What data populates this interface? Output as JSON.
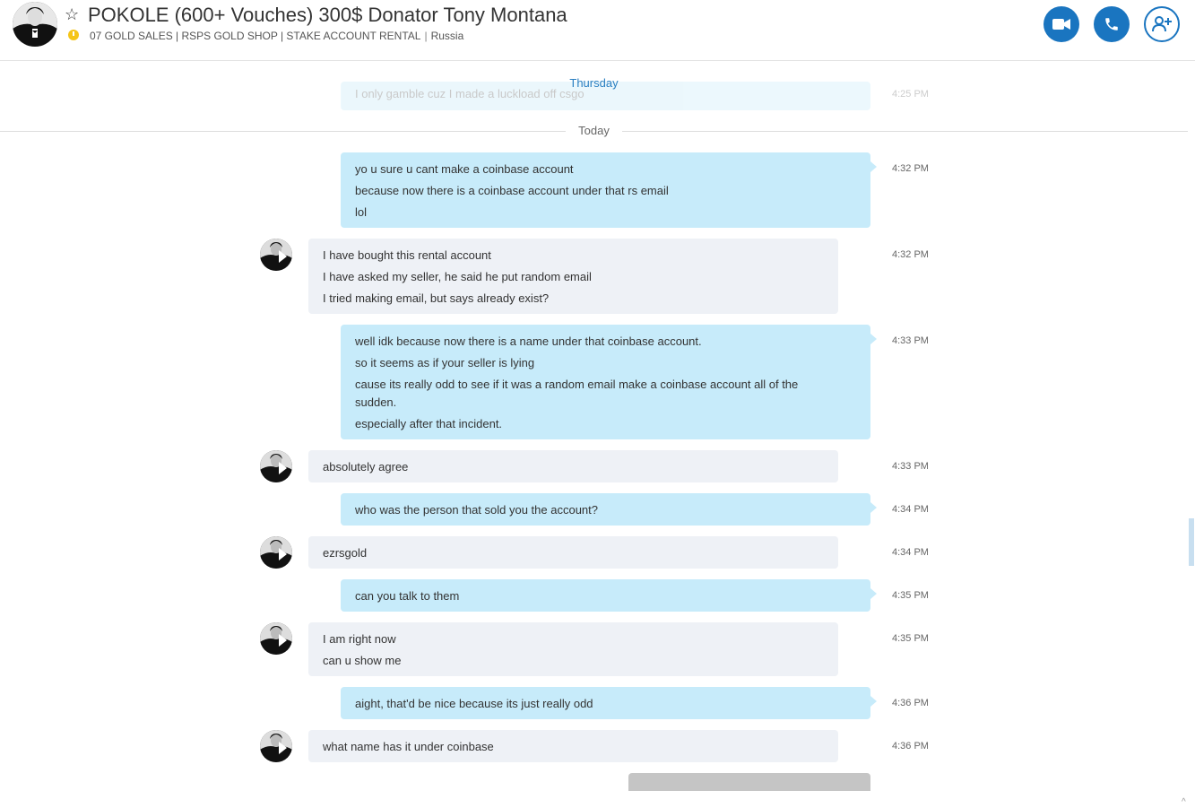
{
  "header": {
    "title": "POKOLE (600+ Vouches) 300$ Donator Tony Montana",
    "mood_parts": [
      "07 GOLD SALES | RSPS GOLD SHOP | STAKE ACCOUNT RENTAL",
      "Russia"
    ],
    "mood_separator": "|",
    "buttons": [
      "video-call",
      "audio-call",
      "add-people"
    ],
    "accent_color": "#1a75c0",
    "status_color": "#f5c518"
  },
  "chat": {
    "faded_message": {
      "text": "I only gamble cuz I made a luckload off csgo",
      "time": "4:25 PM"
    },
    "separators": {
      "thursday": "Thursday",
      "today": "Today"
    },
    "messages": [
      {
        "dir": "out",
        "lines": [
          "yo u sure u cant make a coinbase account",
          "because now there is a coinbase account under that rs email",
          "lol"
        ],
        "time": "4:32 PM"
      },
      {
        "dir": "in",
        "lines": [
          "I have bought this rental account",
          "I have asked my seller, he said he put random email",
          "I tried making email, but says already exist?"
        ],
        "time": "4:32 PM"
      },
      {
        "dir": "out",
        "lines": [
          "well idk because now there is a name under that coinbase account.",
          "so it seems as if your seller is lying",
          "cause its really odd to see if it was a random email make a coinbase account all of the sudden.",
          "especially after that incident."
        ],
        "time": "4:33 PM"
      },
      {
        "dir": "in",
        "lines": [
          "absolutely agree"
        ],
        "time": "4:33 PM"
      },
      {
        "dir": "out",
        "lines": [
          "who was the person that sold you the account?"
        ],
        "time": "4:34 PM"
      },
      {
        "dir": "in",
        "lines": [
          "ezrsgold"
        ],
        "time": "4:34 PM"
      },
      {
        "dir": "out",
        "lines": [
          "can you talk to them"
        ],
        "time": "4:35 PM"
      },
      {
        "dir": "in",
        "lines": [
          "I am right now",
          "can u show me"
        ],
        "time": "4:35 PM"
      },
      {
        "dir": "out",
        "lines": [
          "aight, that'd be nice because its just really odd"
        ],
        "time": "4:36 PM"
      },
      {
        "dir": "in",
        "lines": [
          "what name has it under coinbase"
        ],
        "time": "4:36 PM"
      }
    ],
    "colors": {
      "outgoing": "#c7ebfa",
      "incoming": "#eef1f6"
    }
  },
  "scroll_caret": "^"
}
